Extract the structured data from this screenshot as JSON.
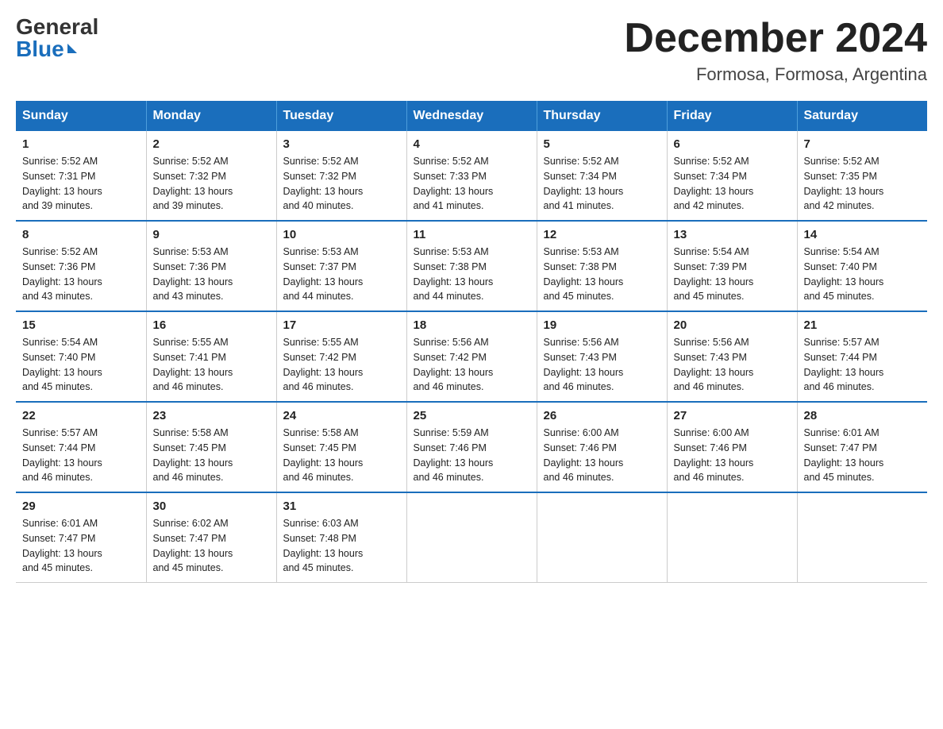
{
  "logo": {
    "general": "General",
    "blue": "Blue"
  },
  "title": {
    "month_year": "December 2024",
    "location": "Formosa, Formosa, Argentina"
  },
  "headers": [
    "Sunday",
    "Monday",
    "Tuesday",
    "Wednesday",
    "Thursday",
    "Friday",
    "Saturday"
  ],
  "weeks": [
    [
      {
        "day": "1",
        "info": "Sunrise: 5:52 AM\nSunset: 7:31 PM\nDaylight: 13 hours\nand 39 minutes."
      },
      {
        "day": "2",
        "info": "Sunrise: 5:52 AM\nSunset: 7:32 PM\nDaylight: 13 hours\nand 39 minutes."
      },
      {
        "day": "3",
        "info": "Sunrise: 5:52 AM\nSunset: 7:32 PM\nDaylight: 13 hours\nand 40 minutes."
      },
      {
        "day": "4",
        "info": "Sunrise: 5:52 AM\nSunset: 7:33 PM\nDaylight: 13 hours\nand 41 minutes."
      },
      {
        "day": "5",
        "info": "Sunrise: 5:52 AM\nSunset: 7:34 PM\nDaylight: 13 hours\nand 41 minutes."
      },
      {
        "day": "6",
        "info": "Sunrise: 5:52 AM\nSunset: 7:34 PM\nDaylight: 13 hours\nand 42 minutes."
      },
      {
        "day": "7",
        "info": "Sunrise: 5:52 AM\nSunset: 7:35 PM\nDaylight: 13 hours\nand 42 minutes."
      }
    ],
    [
      {
        "day": "8",
        "info": "Sunrise: 5:52 AM\nSunset: 7:36 PM\nDaylight: 13 hours\nand 43 minutes."
      },
      {
        "day": "9",
        "info": "Sunrise: 5:53 AM\nSunset: 7:36 PM\nDaylight: 13 hours\nand 43 minutes."
      },
      {
        "day": "10",
        "info": "Sunrise: 5:53 AM\nSunset: 7:37 PM\nDaylight: 13 hours\nand 44 minutes."
      },
      {
        "day": "11",
        "info": "Sunrise: 5:53 AM\nSunset: 7:38 PM\nDaylight: 13 hours\nand 44 minutes."
      },
      {
        "day": "12",
        "info": "Sunrise: 5:53 AM\nSunset: 7:38 PM\nDaylight: 13 hours\nand 45 minutes."
      },
      {
        "day": "13",
        "info": "Sunrise: 5:54 AM\nSunset: 7:39 PM\nDaylight: 13 hours\nand 45 minutes."
      },
      {
        "day": "14",
        "info": "Sunrise: 5:54 AM\nSunset: 7:40 PM\nDaylight: 13 hours\nand 45 minutes."
      }
    ],
    [
      {
        "day": "15",
        "info": "Sunrise: 5:54 AM\nSunset: 7:40 PM\nDaylight: 13 hours\nand 45 minutes."
      },
      {
        "day": "16",
        "info": "Sunrise: 5:55 AM\nSunset: 7:41 PM\nDaylight: 13 hours\nand 46 minutes."
      },
      {
        "day": "17",
        "info": "Sunrise: 5:55 AM\nSunset: 7:42 PM\nDaylight: 13 hours\nand 46 minutes."
      },
      {
        "day": "18",
        "info": "Sunrise: 5:56 AM\nSunset: 7:42 PM\nDaylight: 13 hours\nand 46 minutes."
      },
      {
        "day": "19",
        "info": "Sunrise: 5:56 AM\nSunset: 7:43 PM\nDaylight: 13 hours\nand 46 minutes."
      },
      {
        "day": "20",
        "info": "Sunrise: 5:56 AM\nSunset: 7:43 PM\nDaylight: 13 hours\nand 46 minutes."
      },
      {
        "day": "21",
        "info": "Sunrise: 5:57 AM\nSunset: 7:44 PM\nDaylight: 13 hours\nand 46 minutes."
      }
    ],
    [
      {
        "day": "22",
        "info": "Sunrise: 5:57 AM\nSunset: 7:44 PM\nDaylight: 13 hours\nand 46 minutes."
      },
      {
        "day": "23",
        "info": "Sunrise: 5:58 AM\nSunset: 7:45 PM\nDaylight: 13 hours\nand 46 minutes."
      },
      {
        "day": "24",
        "info": "Sunrise: 5:58 AM\nSunset: 7:45 PM\nDaylight: 13 hours\nand 46 minutes."
      },
      {
        "day": "25",
        "info": "Sunrise: 5:59 AM\nSunset: 7:46 PM\nDaylight: 13 hours\nand 46 minutes."
      },
      {
        "day": "26",
        "info": "Sunrise: 6:00 AM\nSunset: 7:46 PM\nDaylight: 13 hours\nand 46 minutes."
      },
      {
        "day": "27",
        "info": "Sunrise: 6:00 AM\nSunset: 7:46 PM\nDaylight: 13 hours\nand 46 minutes."
      },
      {
        "day": "28",
        "info": "Sunrise: 6:01 AM\nSunset: 7:47 PM\nDaylight: 13 hours\nand 45 minutes."
      }
    ],
    [
      {
        "day": "29",
        "info": "Sunrise: 6:01 AM\nSunset: 7:47 PM\nDaylight: 13 hours\nand 45 minutes."
      },
      {
        "day": "30",
        "info": "Sunrise: 6:02 AM\nSunset: 7:47 PM\nDaylight: 13 hours\nand 45 minutes."
      },
      {
        "day": "31",
        "info": "Sunrise: 6:03 AM\nSunset: 7:48 PM\nDaylight: 13 hours\nand 45 minutes."
      },
      null,
      null,
      null,
      null
    ]
  ]
}
